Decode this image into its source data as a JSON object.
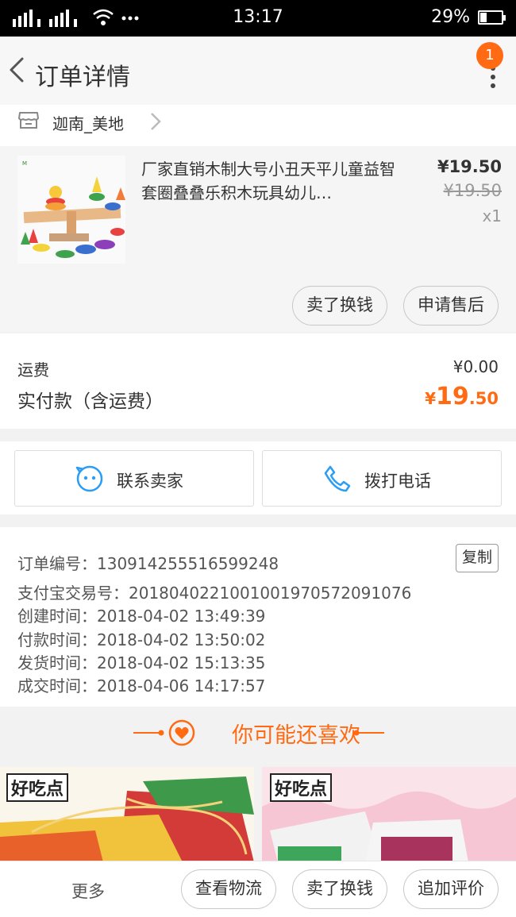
{
  "status_bar": {
    "time": "13:17",
    "battery": "29%",
    "battery_level": 0.29
  },
  "header": {
    "title": "订单详情",
    "notification_count": "1"
  },
  "shop": {
    "name": "迦南_美地"
  },
  "product": {
    "name": "厂家直销木制大号小丑天平儿童益智套圈叠叠乐积木玩具幼儿…",
    "price": "¥19.50",
    "original_price": "¥19.50",
    "quantity": "x1",
    "actions": [
      "卖了换钱",
      "申请售后"
    ]
  },
  "fees": {
    "shipping_label": "运费",
    "shipping_value": "¥0.00",
    "paid_label": "实付款（含运费）",
    "paid_currency": "¥",
    "paid_integer": "19",
    "paid_decimal": ".50"
  },
  "contact": {
    "seller_label": "联系卖家",
    "phone_label": "拨打电话"
  },
  "order_info": {
    "copy_label": "复制",
    "lines": [
      "订单编号：1309142555165992​48",
      "支付宝交易号：2018040221001001970572091076",
      "创建时间：2018-04-02 13:49:39",
      "付款时间：2018-04-02 13:50:02",
      "发货时间：2018-04-02 15:13:35",
      "成交时间：2018-04-06 14:17:57"
    ]
  },
  "recommend": {
    "title": "你可能还喜欢",
    "brand_text": "好吃点"
  },
  "bottom_bar": {
    "more_label": "更多",
    "logistics_label": "查看物流",
    "sell_label": "卖了换钱",
    "review_label": "追加评价"
  },
  "colors": {
    "accent": "#ff6a12",
    "icon_blue": "#2a9df4"
  }
}
